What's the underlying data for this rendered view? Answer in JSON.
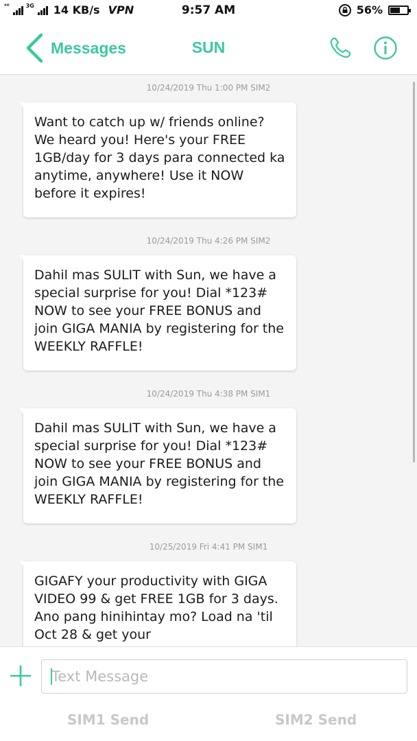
{
  "status_bar": {
    "signal_label": "⁴ᴳ",
    "signal2_label": "3G",
    "speed": "14 KB/s",
    "vpn": "VPN",
    "time": "9:57 AM",
    "battery": "56%"
  },
  "nav": {
    "back_label": "Messages",
    "title": "SUN"
  },
  "messages": [
    {
      "timestamp": "10/24/2019 Thu 1:00 PM  SIM2",
      "text": "Want to catch up w/ friends online? We heard you! Here's your FREE 1GB/day for 3 days para connected ka anytime, anywhere! Use it NOW before it expires!"
    },
    {
      "timestamp": "10/24/2019 Thu 4:26 PM  SIM2",
      "text": "Dahil mas SULIT with Sun, we have a special surprise for you! Dial *123# NOW to see your FREE BONUS and join GIGA MANIA by registering for the WEEKLY RAFFLE!"
    },
    {
      "timestamp": "10/24/2019 Thu 4:38 PM  SIM1",
      "text": "Dahil mas SULIT with Sun, we have a special surprise for you! Dial *123# NOW to see your FREE BONUS and join GIGA MANIA by registering for the WEEKLY RAFFLE!"
    },
    {
      "timestamp": "10/25/2019 Fri 4:41 PM  SIM1",
      "text": "GIGAFY your productivity with GIGA VIDEO 99 & get FREE 1GB for 3 days. Ano pang hinihintay mo? Load na 'til Oct 28 & get your"
    }
  ],
  "composer": {
    "placeholder": "Text Message",
    "sim1_send": "SIM1 Send",
    "sim2_send": "SIM2 Send"
  },
  "colors": {
    "accent": "#3cc7a0"
  }
}
